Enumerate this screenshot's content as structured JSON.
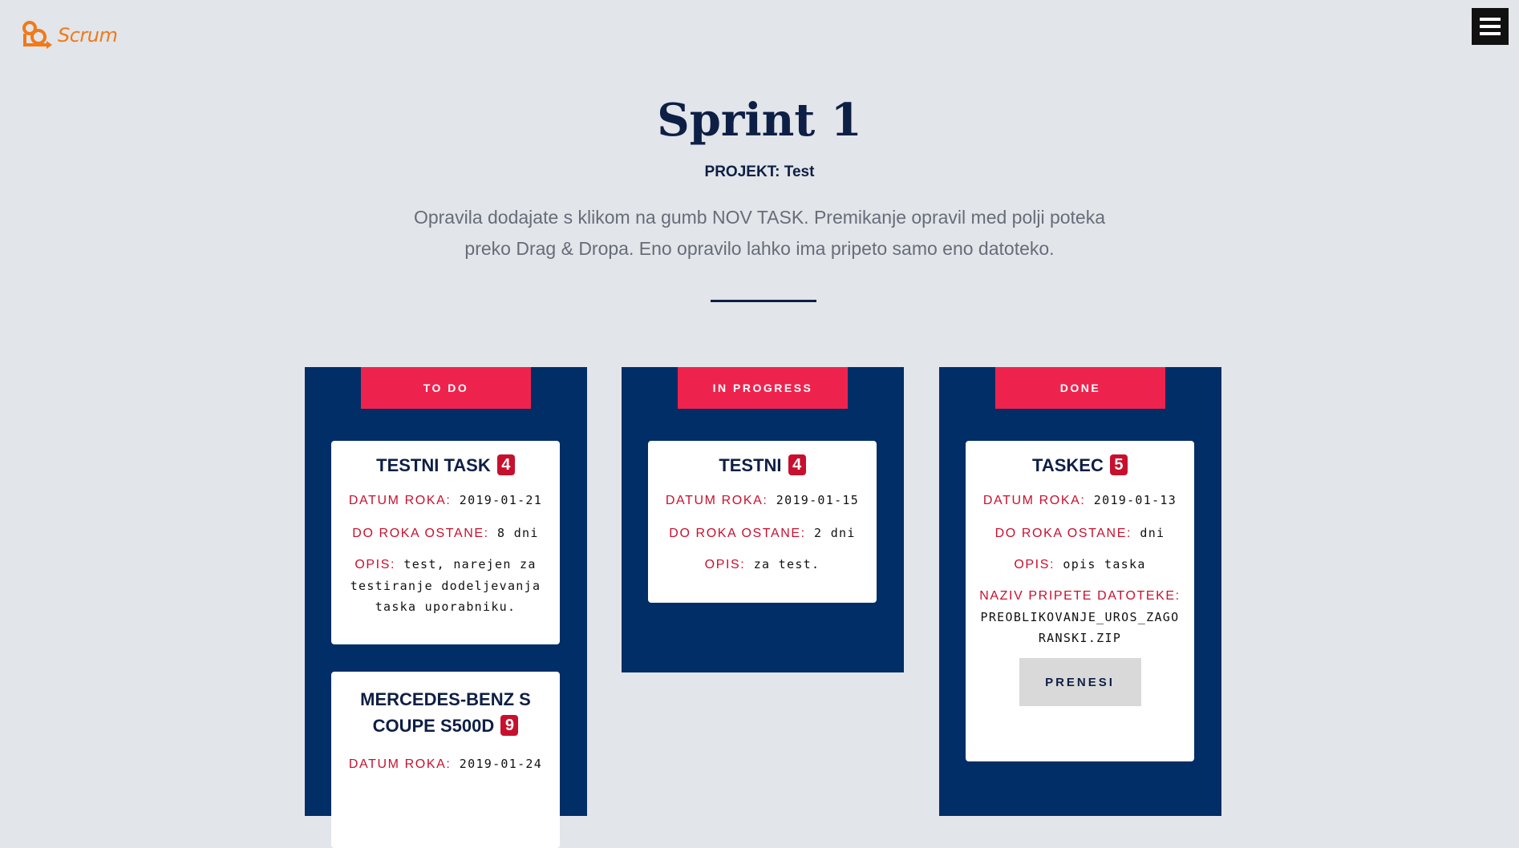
{
  "brand": {
    "name": "Scrum",
    "color": "#f07a1a"
  },
  "menu": {
    "icon": "hamburger-menu-icon"
  },
  "page": {
    "title": "Sprint 1",
    "project_label": "PROJEKT:",
    "project_name": "Test",
    "description": "Opravila dodajate s klikom na gumb NOV TASK. Premikanje opravil med polji poteka preko Drag & Dropa. Eno opravilo lahko ima pripeto samo eno datoteko."
  },
  "colors": {
    "column_bg": "#012e66",
    "column_header": "#ee234d",
    "label": "#c8102e",
    "badge": "#c8102e",
    "title": "#0e1f45"
  },
  "labels": {
    "due_date": "DATUM ROKA:",
    "remaining": "DO ROKA OSTANE:",
    "description": "OPIS:",
    "attachment": "NAZIV PRIPETE DATOTEKE:",
    "download": "PRENESI"
  },
  "columns": [
    {
      "name": "TO DO",
      "cards": [
        {
          "title": "TESTNI TASK",
          "points": "4",
          "due_date": "2019-01-21",
          "remaining": "8 dni",
          "description": "test, narejen za testiranje dodeljevanja taska uporabniku."
        },
        {
          "title": "MERCEDES-BENZ S COUPE S500D",
          "points": "9",
          "due_date": "2019-01-24"
        }
      ]
    },
    {
      "name": "IN PROGRESS",
      "cards": [
        {
          "title": "TESTNI",
          "points": "4",
          "due_date": "2019-01-15",
          "remaining": "2 dni",
          "description": "za test."
        }
      ]
    },
    {
      "name": "DONE",
      "cards": [
        {
          "title": "TASKEC",
          "points": "5",
          "due_date": "2019-01-13",
          "remaining": "dni",
          "description": "opis taska",
          "attachment": "PREOBLIKOVANJE_UROS_ZAGORANSKI.ZIP"
        }
      ]
    }
  ]
}
